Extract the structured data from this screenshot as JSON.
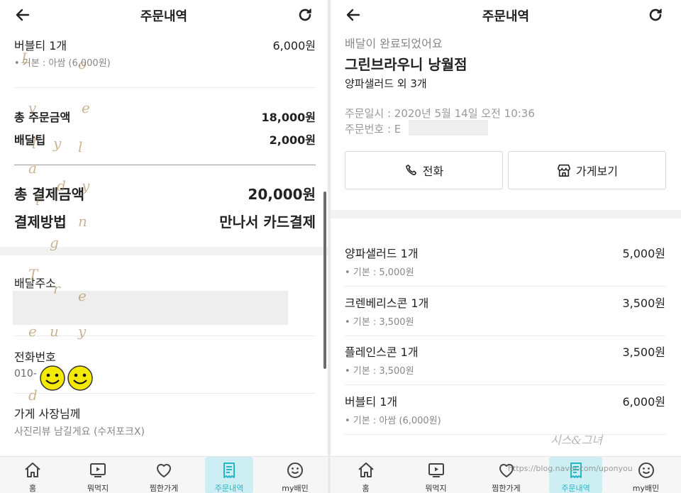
{
  "left": {
    "header": {
      "title": "주문내역"
    },
    "partial_item": {
      "name": "버블티 1개",
      "price": "6,000원",
      "option": "• 기본 : 아쌈 (6,000원)"
    },
    "summary": {
      "order_total_label": "총 주문금액",
      "order_total_value": "18,000원",
      "tip_label": "배달팁",
      "tip_value": "2,000원",
      "pay_total_label": "총 결제금액",
      "pay_total_value": "20,000원",
      "method_label": "결제방법",
      "method_value": "만나서 카드결제"
    },
    "address": {
      "label": "배달주소"
    },
    "phone": {
      "label": "전화번호",
      "value": "010-"
    },
    "owner_note": {
      "label": "가게 사장님께",
      "value": "사진리뷰 남길게요 (수저포크X)"
    }
  },
  "right": {
    "header": {
      "title": "주문내역"
    },
    "status": "배달이 완료되었어요",
    "store_name": "그린브라우니 낭월점",
    "order_summary": "양파샐러드 외 3개",
    "order_time": "주문일시 : 2020년 5월 14일 오전 10:36",
    "order_number_label": "주문번호 : E",
    "order_number_tail": "E",
    "buttons": {
      "call": "전화",
      "store": "가게보기"
    },
    "items": [
      {
        "name": "양파샐러드 1개",
        "price": "5,000원",
        "option": "• 기본 : 5,000원"
      },
      {
        "name": "크렌베리스콘 1개",
        "price": "3,500원",
        "option": "• 기본 : 3,500원"
      },
      {
        "name": "플레인스콘 1개",
        "price": "3,500원",
        "option": "• 기본 : 3,500원"
      },
      {
        "name": "버블티 1개",
        "price": "6,000원",
        "option": "• 기본 : 아쌈 (6,000원)"
      }
    ]
  },
  "nav": [
    {
      "label": "홈",
      "icon": "home-icon"
    },
    {
      "label": "뭐먹지",
      "icon": "play-icon"
    },
    {
      "label": "찜한가게",
      "icon": "heart-icon"
    },
    {
      "label": "주문내역",
      "icon": "receipt-icon",
      "active": true
    },
    {
      "label": "my배민",
      "icon": "smile-icon"
    }
  ],
  "overlay": {
    "watermark_left": [
      "L",
      "o",
      "v",
      "e",
      "l",
      "y",
      "l",
      "a",
      "d",
      "y",
      "i",
      "n",
      "g",
      "T",
      "r",
      "e",
      "e",
      "u",
      "y",
      "d"
    ],
    "watermark_right_logo": "시스&그녀",
    "watermark_right_url": "https://blog.naver.com/uponyou"
  },
  "colors": {
    "accent": "#2ab7c4",
    "active_bg": "#cdeef2",
    "band": "#f2f2f2",
    "redact": "#eeeeee"
  }
}
